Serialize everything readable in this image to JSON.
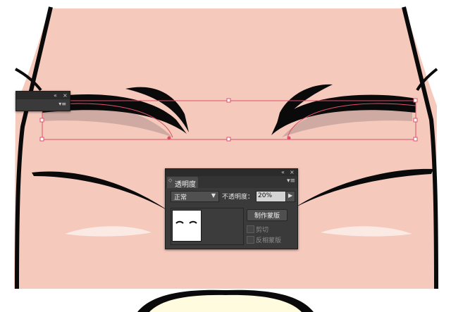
{
  "colors": {
    "skin": "#f5c9bc",
    "outline": "#0a0a0a",
    "shadow": "#cfaaa2",
    "selection": "#e0506a",
    "highlight": "#fbeae4",
    "teeth": "#fffbdf",
    "panel_bg": "#3a3a3a"
  },
  "mini_panel": {
    "collapse_icon": "«",
    "close_icon": "×",
    "menu_icon": "▾≡"
  },
  "transparency_panel": {
    "collapse_icon": "«",
    "close_icon": "×",
    "tab_arrows_icon": "◇",
    "tab_label": "透明度",
    "menu_icon": "▾≡",
    "blend_mode": "正常",
    "blend_caret": "▼",
    "opacity_label": "不透明度：",
    "opacity_value": "20%",
    "opacity_arrow": "▶",
    "make_mask_label": "制作蒙版",
    "clip_label": "剪切",
    "invert_mask_label": "反相蒙版"
  }
}
